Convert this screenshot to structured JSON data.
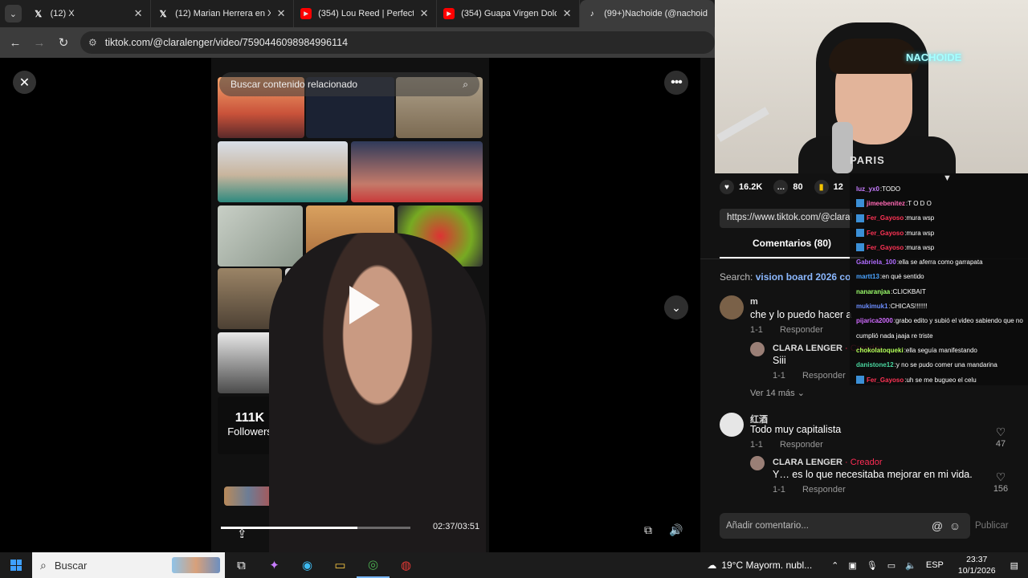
{
  "browser": {
    "tabs": [
      {
        "icon": "x",
        "title": "(12) X"
      },
      {
        "icon": "x",
        "title": "(12) Marian Herrera en X: \""
      },
      {
        "icon": "yt",
        "title": "(354) Lou Reed | Perfect Da"
      },
      {
        "icon": "yt",
        "title": "(354) Guapa Virgen Dolore"
      },
      {
        "icon": "tt",
        "title": "(99+)Nachoide (@nachoid"
      }
    ],
    "url": "tiktok.com/@claralenger/video/7590446098984996114"
  },
  "video": {
    "search_text": "Buscar contenido relacionado",
    "followers_count": "111K",
    "followers_label": "Followers",
    "progress": 0.72,
    "time": "02:37/03:51"
  },
  "panel": {
    "likes": "16.2K",
    "comments": "80",
    "saves": "12",
    "link": "https://www.tiktok.com/@claral",
    "comments_tab": "Comentarios (80)",
    "search_label": "Search:",
    "search_keyword": "vision board 2026 co",
    "reply_label": "Responder",
    "more_replies": "Ver 14 más",
    "creator_label": "· Creador",
    "comment_list": [
      {
        "user": "m",
        "text": "che y lo puedo hacer a",
        "date": "1-1"
      },
      {
        "user": "CLARA LENGER",
        "text": "Siii",
        "date": "1-1"
      },
      {
        "user": "红酒",
        "text": "Todo muy capitalista",
        "date": "1-1",
        "likes": "47"
      },
      {
        "user": "CLARA LENGER",
        "text": "Y… es lo que necesitaba mejorar en mi vida.",
        "date": "1-1",
        "likes": "156"
      }
    ],
    "input_placeholder": "Añadir comentario...",
    "publish": "Publicar"
  },
  "cam": {
    "shirt": "PARIS",
    "neon": "NACHOIDE"
  },
  "chat": [
    {
      "user": "luz_yx0",
      "color": "#c77dff",
      "text": "TODO",
      "badge": false
    },
    {
      "user": "jimeebenitez",
      "color": "#ff69b4",
      "text": "T O D O",
      "badge": true
    },
    {
      "user": "Fer_Gayoso",
      "color": "#ff3355",
      "text": "mura wsp",
      "badge": true
    },
    {
      "user": "Fer_Gayoso",
      "color": "#ff3355",
      "text": "mura wsp",
      "badge": true
    },
    {
      "user": "Fer_Gayoso",
      "color": "#ff3355",
      "text": "mura wsp",
      "badge": true
    },
    {
      "user": "Gabriela_100",
      "color": "#b06cff",
      "text": "ella se aferra como garrapata",
      "badge": false
    },
    {
      "user": "martt13",
      "color": "#4aa3ff",
      "text": "en qué sentido",
      "badge": false
    },
    {
      "user": "nanaranjaa",
      "color": "#9cff6b",
      "text": "CLICKBAIT",
      "badge": false
    },
    {
      "user": "mukimuk1",
      "color": "#6c8dff",
      "text": "CHICAS!!!!!!!",
      "badge": false
    },
    {
      "user": "pijarica2000",
      "color": "#d06bff",
      "text": "grabo edito y subió el video sabiendo que no",
      "badge": false
    },
    {
      "user": "",
      "color": "#ffffff",
      "text": "cumplió nada jaaja re triste",
      "badge": false
    },
    {
      "user": "chokolatoqueki",
      "color": "#b2ff59",
      "text": "ella seguía manifestando",
      "badge": false
    },
    {
      "user": "danistone12",
      "color": "#4ad7a0",
      "text": "y no se pudo comer una mandarina",
      "badge": false
    },
    {
      "user": "Fer_Gayoso",
      "color": "#ff3355",
      "text": "uh se me bugueo el celu",
      "badge": true
    }
  ],
  "taskbar": {
    "search": "Buscar",
    "weather": "19°C  Mayorm. nubl...",
    "lang": "ESP",
    "time": "23:37",
    "date": "10/1/2026"
  }
}
